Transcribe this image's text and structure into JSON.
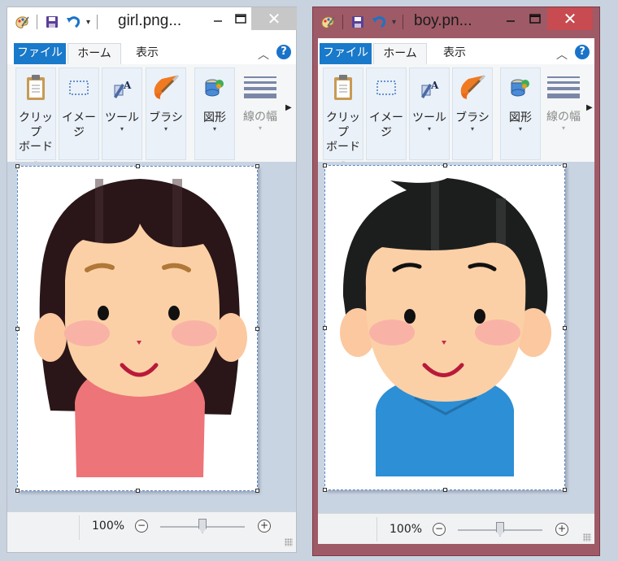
{
  "windows": [
    {
      "title": "girl.png...",
      "menu": {
        "file": "ファイル",
        "home": "ホーム",
        "view": "表示"
      },
      "ribbon": [
        {
          "line1": "クリップ",
          "line2": "ボード",
          "icon": "clipboard-icon"
        },
        {
          "line1": "イメージ",
          "line2": "",
          "icon": "select-rect-icon"
        },
        {
          "line1": "ツール",
          "line2": "",
          "icon": "tools-icon"
        },
        {
          "line1": "ブラシ",
          "line2": "",
          "icon": "brush-icon"
        },
        {
          "line1": "図形",
          "line2": "",
          "icon": "shapes-icon"
        },
        {
          "line1": "線の幅",
          "line2": "",
          "icon": "line-width-icon"
        }
      ],
      "zoom": "100%",
      "zoom_level": 0.5,
      "image_subject": "girl"
    },
    {
      "title": "boy.pn...",
      "menu": {
        "file": "ファイル",
        "home": "ホーム",
        "view": "表示"
      },
      "ribbon": [
        {
          "line1": "クリップ",
          "line2": "ボード",
          "icon": "clipboard-icon"
        },
        {
          "line1": "イメージ",
          "line2": "",
          "icon": "select-rect-icon"
        },
        {
          "line1": "ツール",
          "line2": "",
          "icon": "tools-icon"
        },
        {
          "line1": "ブラシ",
          "line2": "",
          "icon": "brush-icon"
        },
        {
          "line1": "図形",
          "line2": "",
          "icon": "shapes-icon"
        },
        {
          "line1": "線の幅",
          "line2": "",
          "icon": "line-width-icon"
        }
      ],
      "zoom": "100%",
      "zoom_level": 0.5,
      "image_subject": "boy"
    }
  ],
  "colors": {
    "accent": "#1979ca",
    "active_window_frame": "#9e5a66",
    "close_button_active": "#c74b50",
    "canvas_bg": "#c9d4e2"
  }
}
